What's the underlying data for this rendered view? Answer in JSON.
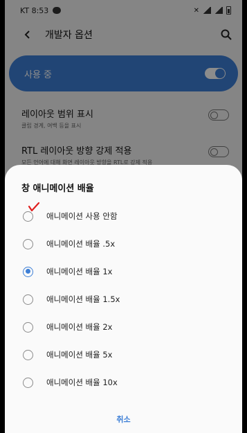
{
  "status_bar": {
    "carrier_time": "KT 8:53"
  },
  "header": {
    "title": "개발자 옵션"
  },
  "master_switch": {
    "label": "사용 중",
    "on": true
  },
  "settings": [
    {
      "name": "레이아웃 범위 표시",
      "desc": "클립 경계, 여백 등을 표시",
      "on": false
    },
    {
      "name": "RTL 레이아웃 방향 강제 적용",
      "desc": "모든 언어에 대해 화면 레이아웃 방향을 RTL로 강제 적용",
      "on": false
    }
  ],
  "dialog": {
    "title": "창 애니메이션 배율",
    "options": [
      {
        "label": "애니메이션 사용 안함",
        "selected": false
      },
      {
        "label": "애니메이션 배율 .5x",
        "selected": false
      },
      {
        "label": "애니메이션 배율 1x",
        "selected": true
      },
      {
        "label": "애니메이션 배율 1.5x",
        "selected": false
      },
      {
        "label": "애니메이션 배율 2x",
        "selected": false
      },
      {
        "label": "애니메이션 배율 5x",
        "selected": false
      },
      {
        "label": "애니메이션 배율 10x",
        "selected": false
      }
    ],
    "cancel_label": "취소"
  },
  "colors": {
    "accent": "#3d7fd6",
    "annotation": "#e01f1f"
  }
}
